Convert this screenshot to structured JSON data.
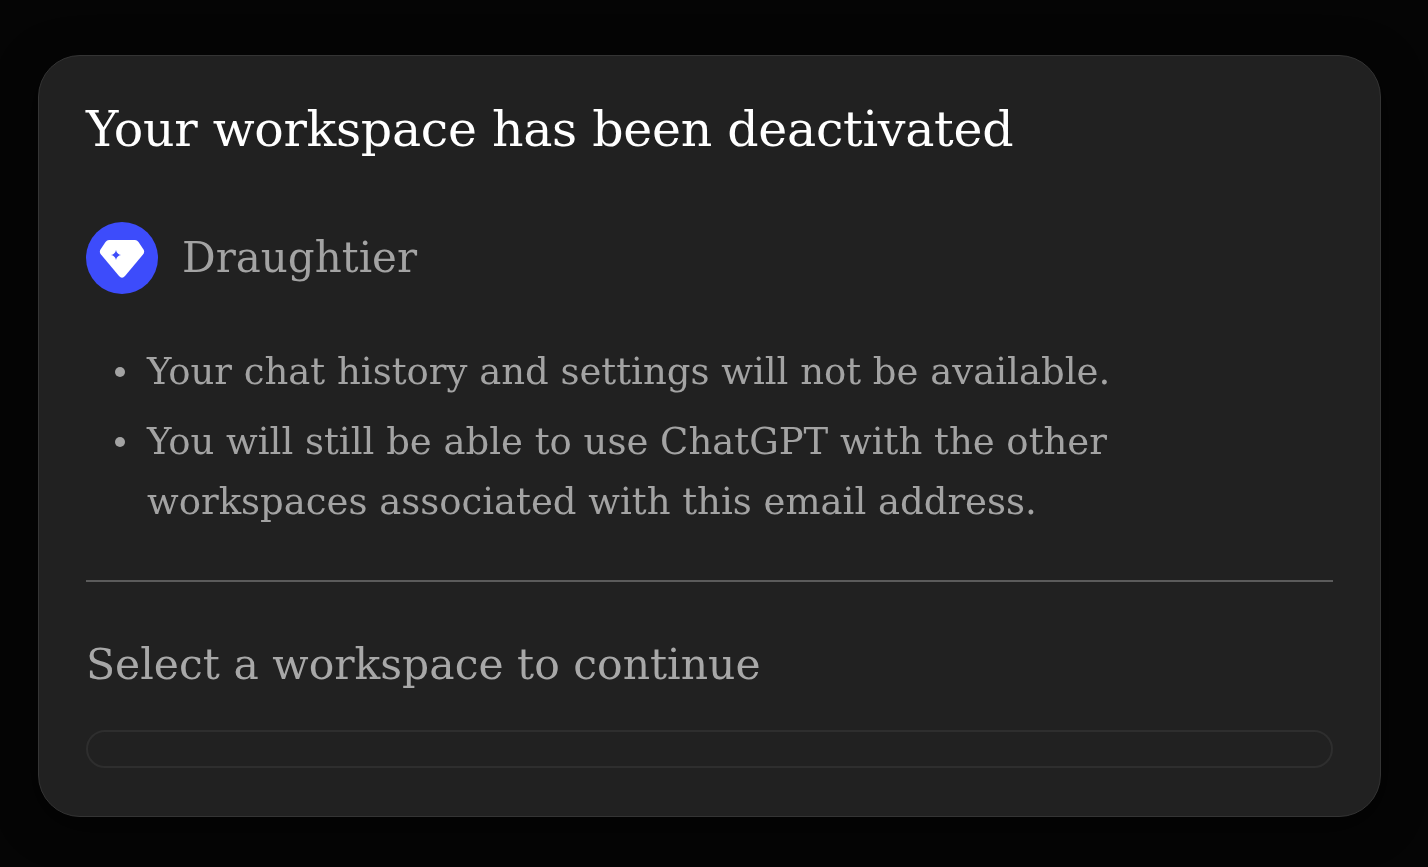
{
  "dialog": {
    "title": "Your workspace has been deactivated",
    "workspace": {
      "name": "Draughtier"
    },
    "notes": [
      "Your chat history and settings will not be available.",
      "You will still be able to use ChatGPT with the other workspaces associated with this email address."
    ],
    "prompt": "Select a workspace to continue"
  }
}
